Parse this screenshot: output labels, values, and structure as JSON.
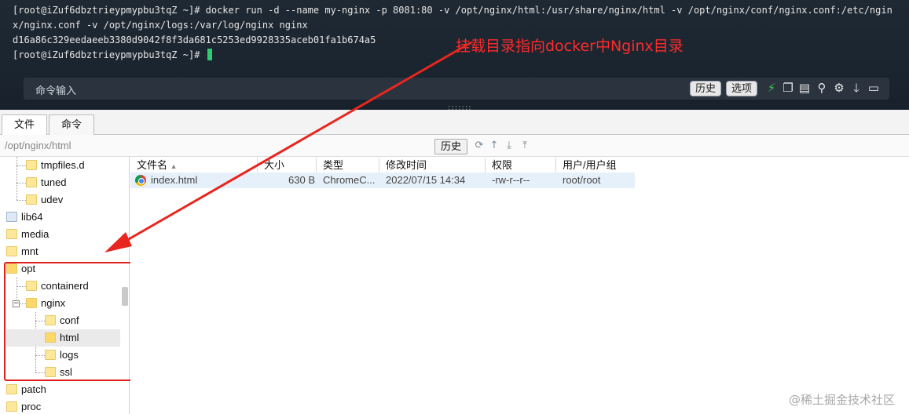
{
  "terminal": {
    "line1": "[root@iZuf6dbztrieypmypbu3tqZ ~]# docker run -d --name my-nginx -p 8081:80 -v /opt/nginx/html:/usr/share/nginx/html -v /opt/nginx/conf/nginx.conf:/etc/nginx/nginx.conf -v /opt/nginx/logs:/var/log/nginx nginx",
    "line2": "d16a86c329eedaeeb3380d9042f8f3da681c5253ed9928335aceb01fa1b674a5",
    "line3": "[root@iZuf6dbztrieypmypbu3tqZ ~]#"
  },
  "annotation": "挂载目录指向docker中Nginx目录",
  "cmdbar": {
    "label": "命令输入",
    "history_btn": "历史",
    "options_btn": "选项"
  },
  "tabs": {
    "files": "文件",
    "commands": "命令"
  },
  "pathbar": {
    "path": "/opt/nginx/html",
    "history_btn": "历史"
  },
  "tree": {
    "items": [
      "tmpfiles.d",
      "tuned",
      "udev",
      "lib64",
      "media",
      "mnt",
      "opt",
      "containerd",
      "nginx",
      "conf",
      "html",
      "logs",
      "ssl",
      "patch",
      "proc"
    ]
  },
  "filelist": {
    "columns": [
      "文件名",
      "大小",
      "类型",
      "修改时间",
      "权限",
      "用户/用户组"
    ],
    "rows": [
      {
        "name": "index.html",
        "size": "630 B",
        "type": "ChromeC...",
        "modified": "2022/07/15 14:34",
        "perm": "-rw-r--r--",
        "owner": "root/root"
      }
    ]
  },
  "watermark": "@稀土掘金技术社区",
  "colors": {
    "annotation": "#ff2a2a",
    "highlight_box": "#e01f1f",
    "cursor": "#2ecc71"
  }
}
